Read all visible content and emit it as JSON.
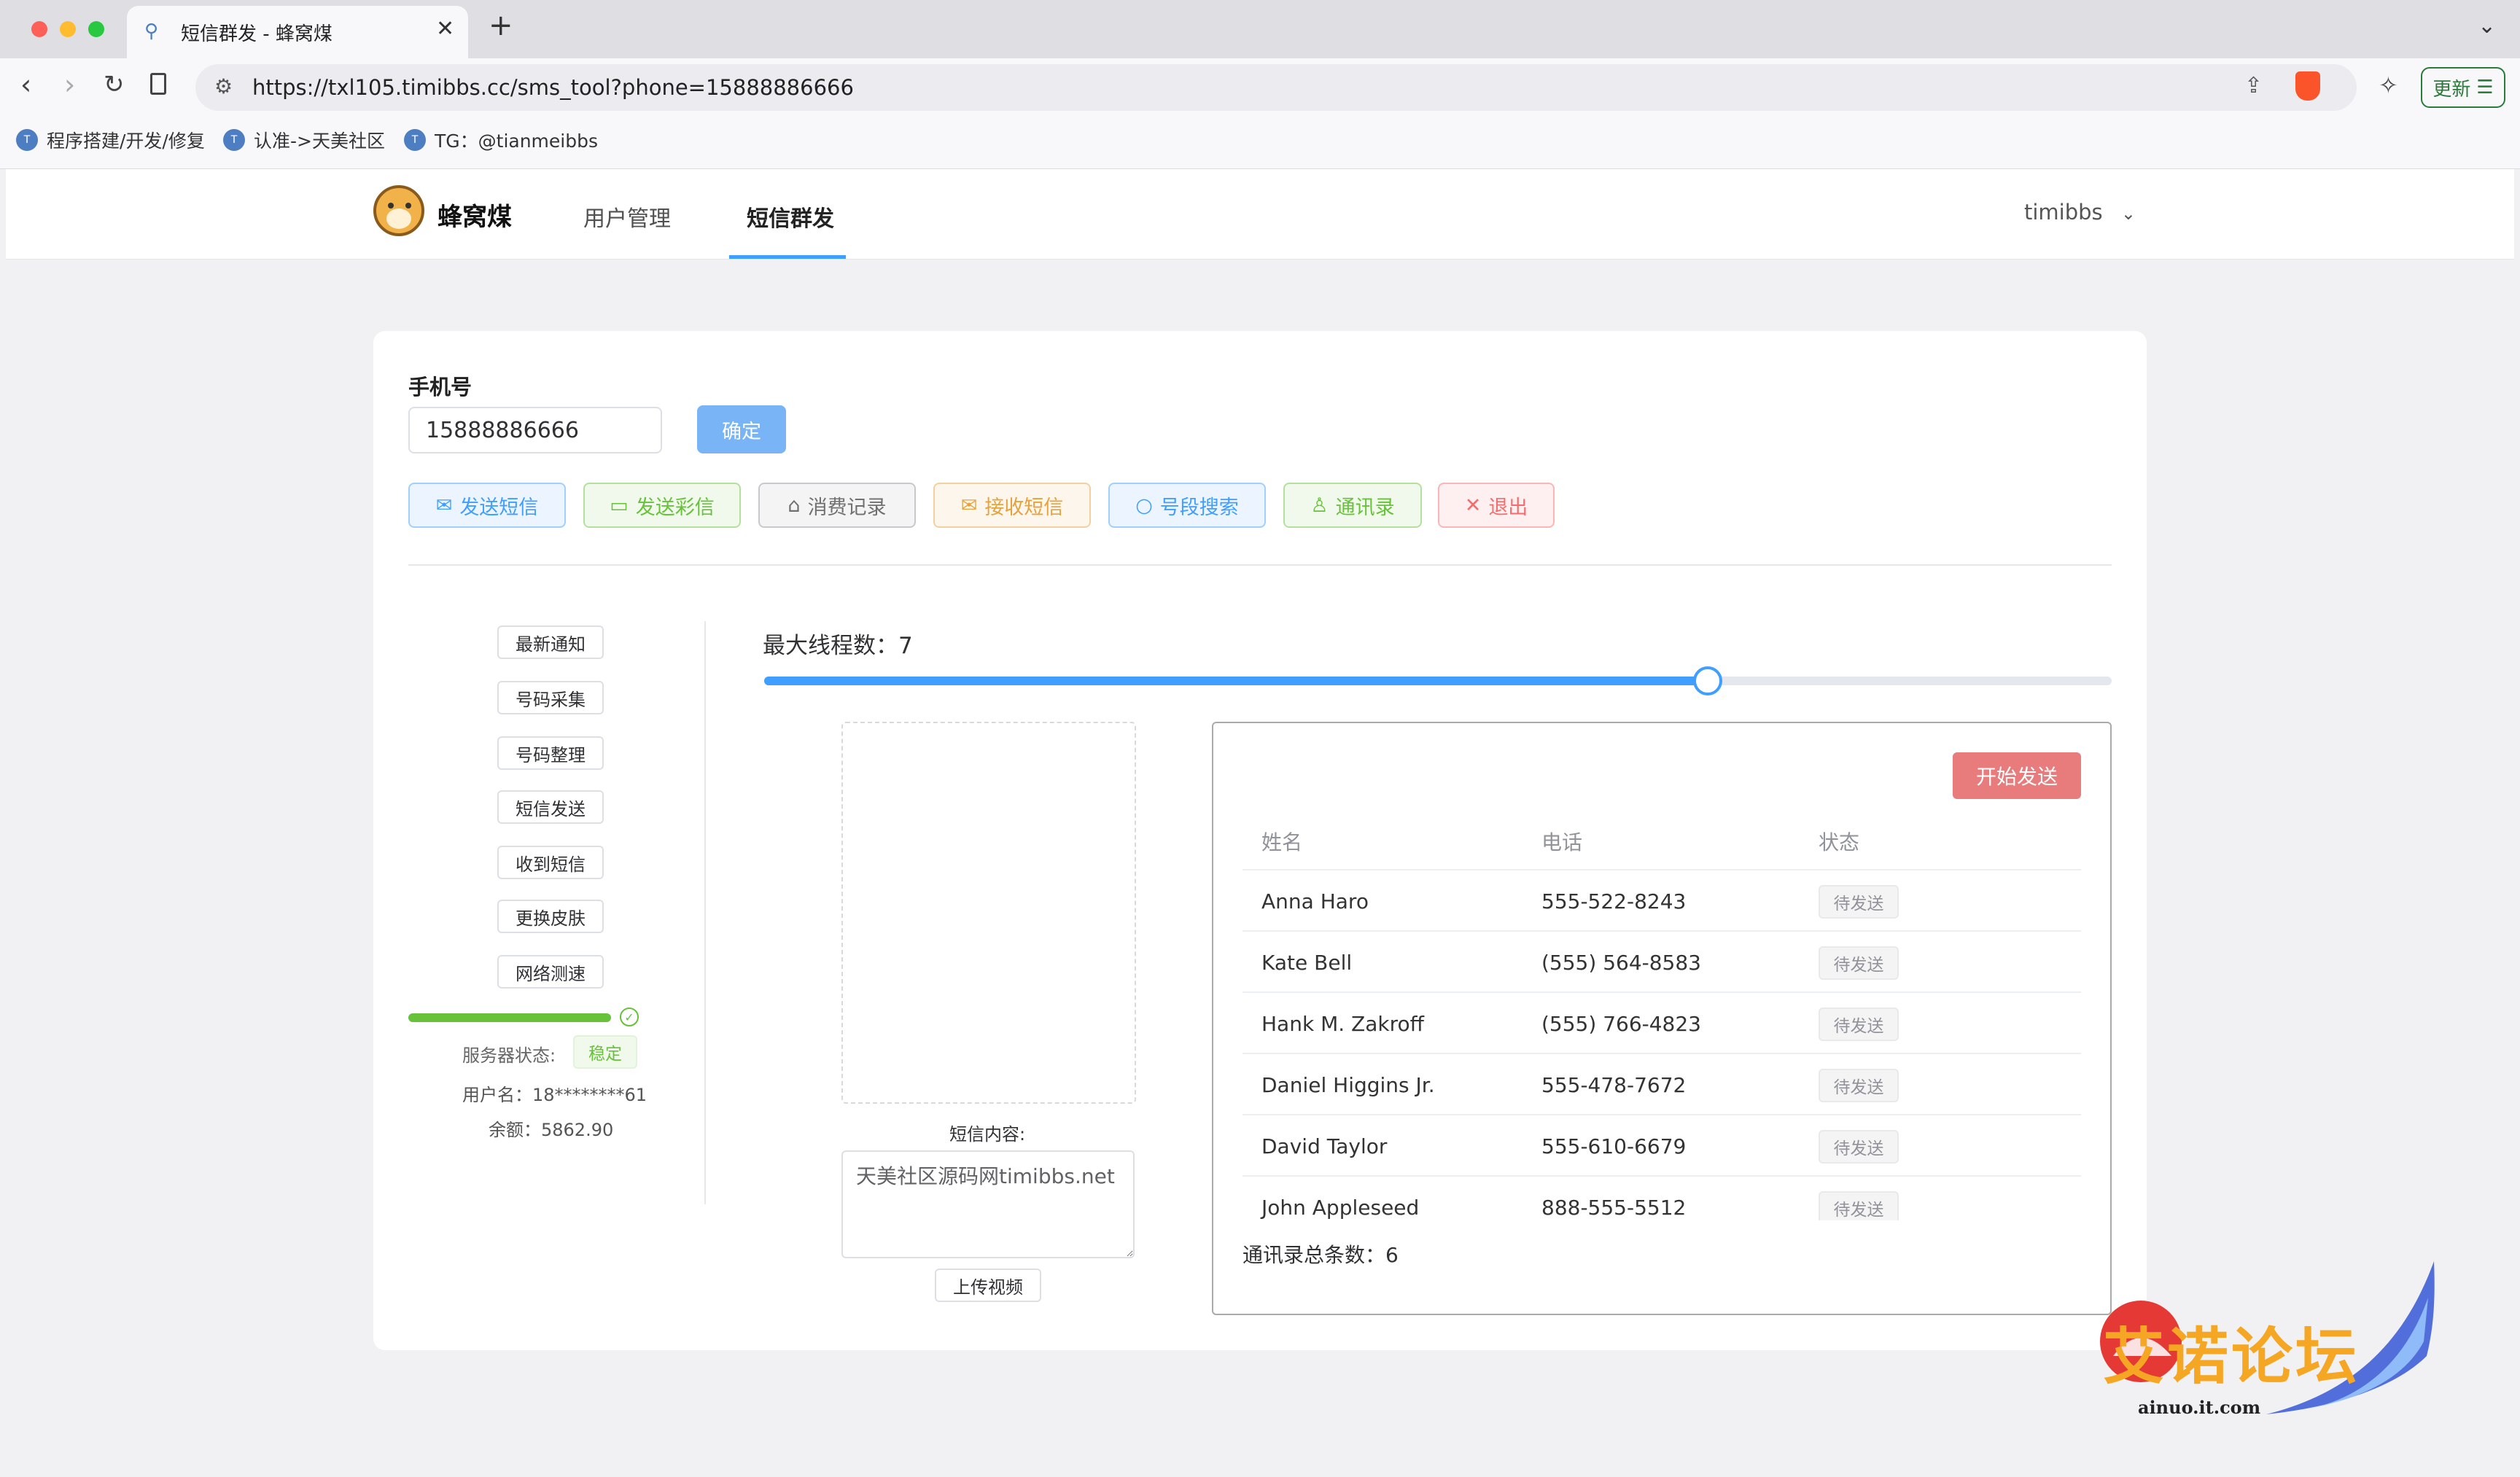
{
  "browser": {
    "tab_title": "短信群发 - 蜂窝煤",
    "url": "https://txl105.timibbs.cc/sms_tool?phone=15888886666",
    "update_label": "更新",
    "bookmarks": [
      "程序搭建/开发/修复",
      "认准->天美社区",
      "TG：@tianmeibbs"
    ]
  },
  "app": {
    "brand": "蜂窝煤",
    "nav": [
      "用户管理",
      "短信群发"
    ],
    "user": "timibbs"
  },
  "form": {
    "phone_label": "手机号",
    "phone_value": "15888886666",
    "confirm_label": "确定"
  },
  "actions": [
    {
      "label": "发送短信",
      "icon": "mail-icon",
      "color": "#409eff"
    },
    {
      "label": "发送彩信",
      "icon": "archive-icon",
      "color": "#67c23a"
    },
    {
      "label": "消费记录",
      "icon": "home-icon",
      "color": "#909399"
    },
    {
      "label": "接收短信",
      "icon": "mail-icon",
      "color": "#e6a23c"
    },
    {
      "label": "号段搜索",
      "icon": "search-icon",
      "color": "#409eff"
    },
    {
      "label": "通讯录",
      "icon": "user-icon",
      "color": "#67c23a"
    },
    {
      "label": "退出",
      "icon": "close-icon",
      "color": "#f56c6c"
    }
  ],
  "sidebar": {
    "items": [
      "最新通知",
      "号码采集",
      "号码整理",
      "短信发送",
      "收到短信",
      "更换皮肤",
      "网络测速"
    ],
    "progress_percent": 100,
    "server_status_label": "服务器状态:",
    "server_status_value": "稳定",
    "username": "用户名：18********61",
    "balance": "余额：5862.90"
  },
  "threads": {
    "label": "最大线程数：7",
    "value": 7,
    "slider_fraction": 0.7
  },
  "message": {
    "content_label": "短信内容:",
    "content_value": "天美社区源码网timibbs.net",
    "upload_label": "上传视频"
  },
  "contacts": {
    "start_label": "开始发送",
    "columns": [
      "姓名",
      "电话",
      "状态"
    ],
    "rows": [
      {
        "name": "Anna Haro",
        "phone": "555-522-8243",
        "status": "待发送"
      },
      {
        "name": "Kate Bell",
        "phone": "(555) 564-8583",
        "status": "待发送"
      },
      {
        "name": "Hank M. Zakroff",
        "phone": "(555) 766-4823",
        "status": "待发送"
      },
      {
        "name": "Daniel Higgins Jr.",
        "phone": "555-478-7672",
        "status": "待发送"
      },
      {
        "name": "David Taylor",
        "phone": "555-610-6679",
        "status": "待发送"
      },
      {
        "name": "John Appleseed",
        "phone": "888-555-5512",
        "status": "待发送"
      }
    ],
    "total_label": "通讯录总条数：",
    "total_value": "6"
  },
  "watermark": {
    "title": "艾诺论坛",
    "site": "ainuo.it.com"
  },
  "colors": {
    "primary": "#409eff",
    "danger_button": "#e87c7c",
    "success": "#67c23a"
  }
}
